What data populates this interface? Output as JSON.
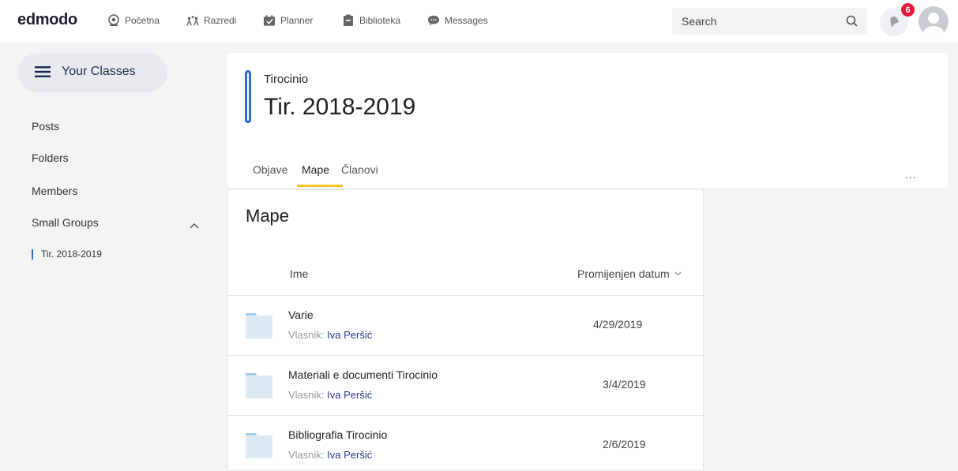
{
  "topbar": {
    "logo": "edmodo",
    "nav": [
      {
        "label": "Početna",
        "icon": "home-icon"
      },
      {
        "label": "Razredi",
        "icon": "classes-icon"
      },
      {
        "label": "Planner",
        "icon": "planner-icon"
      },
      {
        "label": "Biblioteka",
        "icon": "library-icon"
      },
      {
        "label": "Messages",
        "icon": "messages-icon"
      }
    ],
    "search_placeholder": "Search",
    "notification_count": "6"
  },
  "sidebar": {
    "your_classes_label": "Your Classes",
    "links": [
      "Posts",
      "Folders",
      "Members",
      "Small Groups"
    ],
    "group_item": "Tir. 2018-2019"
  },
  "header": {
    "subtitle": "Tirocinio",
    "title": "Tir. 2018-2019",
    "tabs": [
      "Objave",
      "Mape",
      "Članovi"
    ],
    "active_tab": "Mape",
    "more_label": "..."
  },
  "folders": {
    "title": "Mape",
    "col_name": "Ime",
    "col_date": "Promijenjen datum",
    "owner_prefix": "Vlasnik:",
    "rows": [
      {
        "name": "Varie",
        "owner": "Iva Peršić",
        "date": "4/29/2019"
      },
      {
        "name": "Materiali e documenti Tirocinio",
        "owner": "Iva Peršić",
        "date": "3/4/2019"
      },
      {
        "name": "Bibliografia Tirocinio",
        "owner": "Iva Peršić",
        "date": "2/6/2019"
      }
    ]
  },
  "colors": {
    "accent_blue": "#2d6ad4",
    "tab_underline": "#f2c327",
    "badge_red": "#e8193c",
    "folder_blue": "#dde9f3"
  }
}
